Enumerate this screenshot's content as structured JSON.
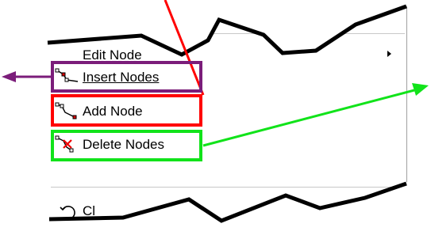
{
  "menu": {
    "items": [
      {
        "label": "Edit Node",
        "icon": "node-edit-icon",
        "has_submenu": true
      },
      {
        "label": "Insert Nodes",
        "icon": "insert-nodes-icon"
      },
      {
        "label": "Add Node",
        "icon": "add-node-icon"
      },
      {
        "label": "Delete Nodes",
        "icon": "delete-nodes-icon"
      },
      {
        "label": "Cl",
        "icon": "clear-rotate-icon"
      }
    ]
  },
  "annotations": {
    "colors": {
      "purple": "#7b1d7a",
      "red": "#ff0000",
      "green": "#11e31a"
    }
  }
}
